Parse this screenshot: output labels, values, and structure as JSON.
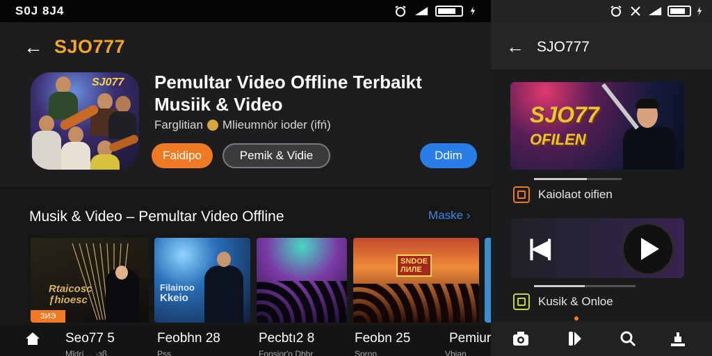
{
  "left_status": {
    "time": "S0J 8J4"
  },
  "left_header": {
    "back_icon": "arrow-left-icon",
    "title": "SJO777",
    "title_color": "#f4a32b"
  },
  "app_info": {
    "icon_text": "SJ077",
    "title": "Pemultar Video Offline Terbaikt Musiik & Video",
    "subtitle_prefix": "Farglitian",
    "subtitle_suffix": "Mlieumnör ioder (ifń)",
    "buttons": {
      "orange": "Faidipo",
      "outline": "Pemik & Vidie",
      "blue": "Ddim"
    },
    "colors": {
      "orange": "#f07a23",
      "blue": "#2a7de6"
    }
  },
  "section": {
    "title": "Musik & Video – Pemultar Video Offline",
    "more_label": "Maske ›"
  },
  "thumbnails": [
    {
      "caption_line1": "Rtaicosc",
      "caption_line2": "ƒhioesc",
      "tag": "ЗИЭ"
    },
    {
      "caption_line1": "Filainoo",
      "caption_line2": "Kkeio"
    },
    {
      "caption_line1": ""
    },
    {
      "sign_line1": "SNDOE",
      "sign_line2": "ЛИЛЕ"
    }
  ],
  "bottom_items": [
    {
      "label": "Seo77 5",
      "sub": "Mǐdrí ... ·ɜβ"
    },
    {
      "label": "Feobhn 28",
      "sub": "Pss"
    },
    {
      "label": "Pecbtı2 8",
      "sub": "Fonsior'o Dhbr"
    },
    {
      "label": "Feobn 25",
      "sub": "Soron"
    },
    {
      "label": "Pemiur",
      "sub": "Vbian"
    }
  ],
  "right_header": {
    "back_icon": "arrow-left-icon",
    "title": "SJO777"
  },
  "right_banner": {
    "line1": "SJO77",
    "line2": "OFILEN"
  },
  "right_items": [
    {
      "label": "Kaiolaot oifien",
      "checkbox_color": "#f07a23",
      "progress": 0.6
    },
    {
      "label": "Kusik & Onloe",
      "checkbox_color": "#c8d24a",
      "progress": 0.5
    }
  ],
  "right_nav": [
    "camera-icon",
    "media-icon",
    "search-icon",
    "upload-icon"
  ]
}
